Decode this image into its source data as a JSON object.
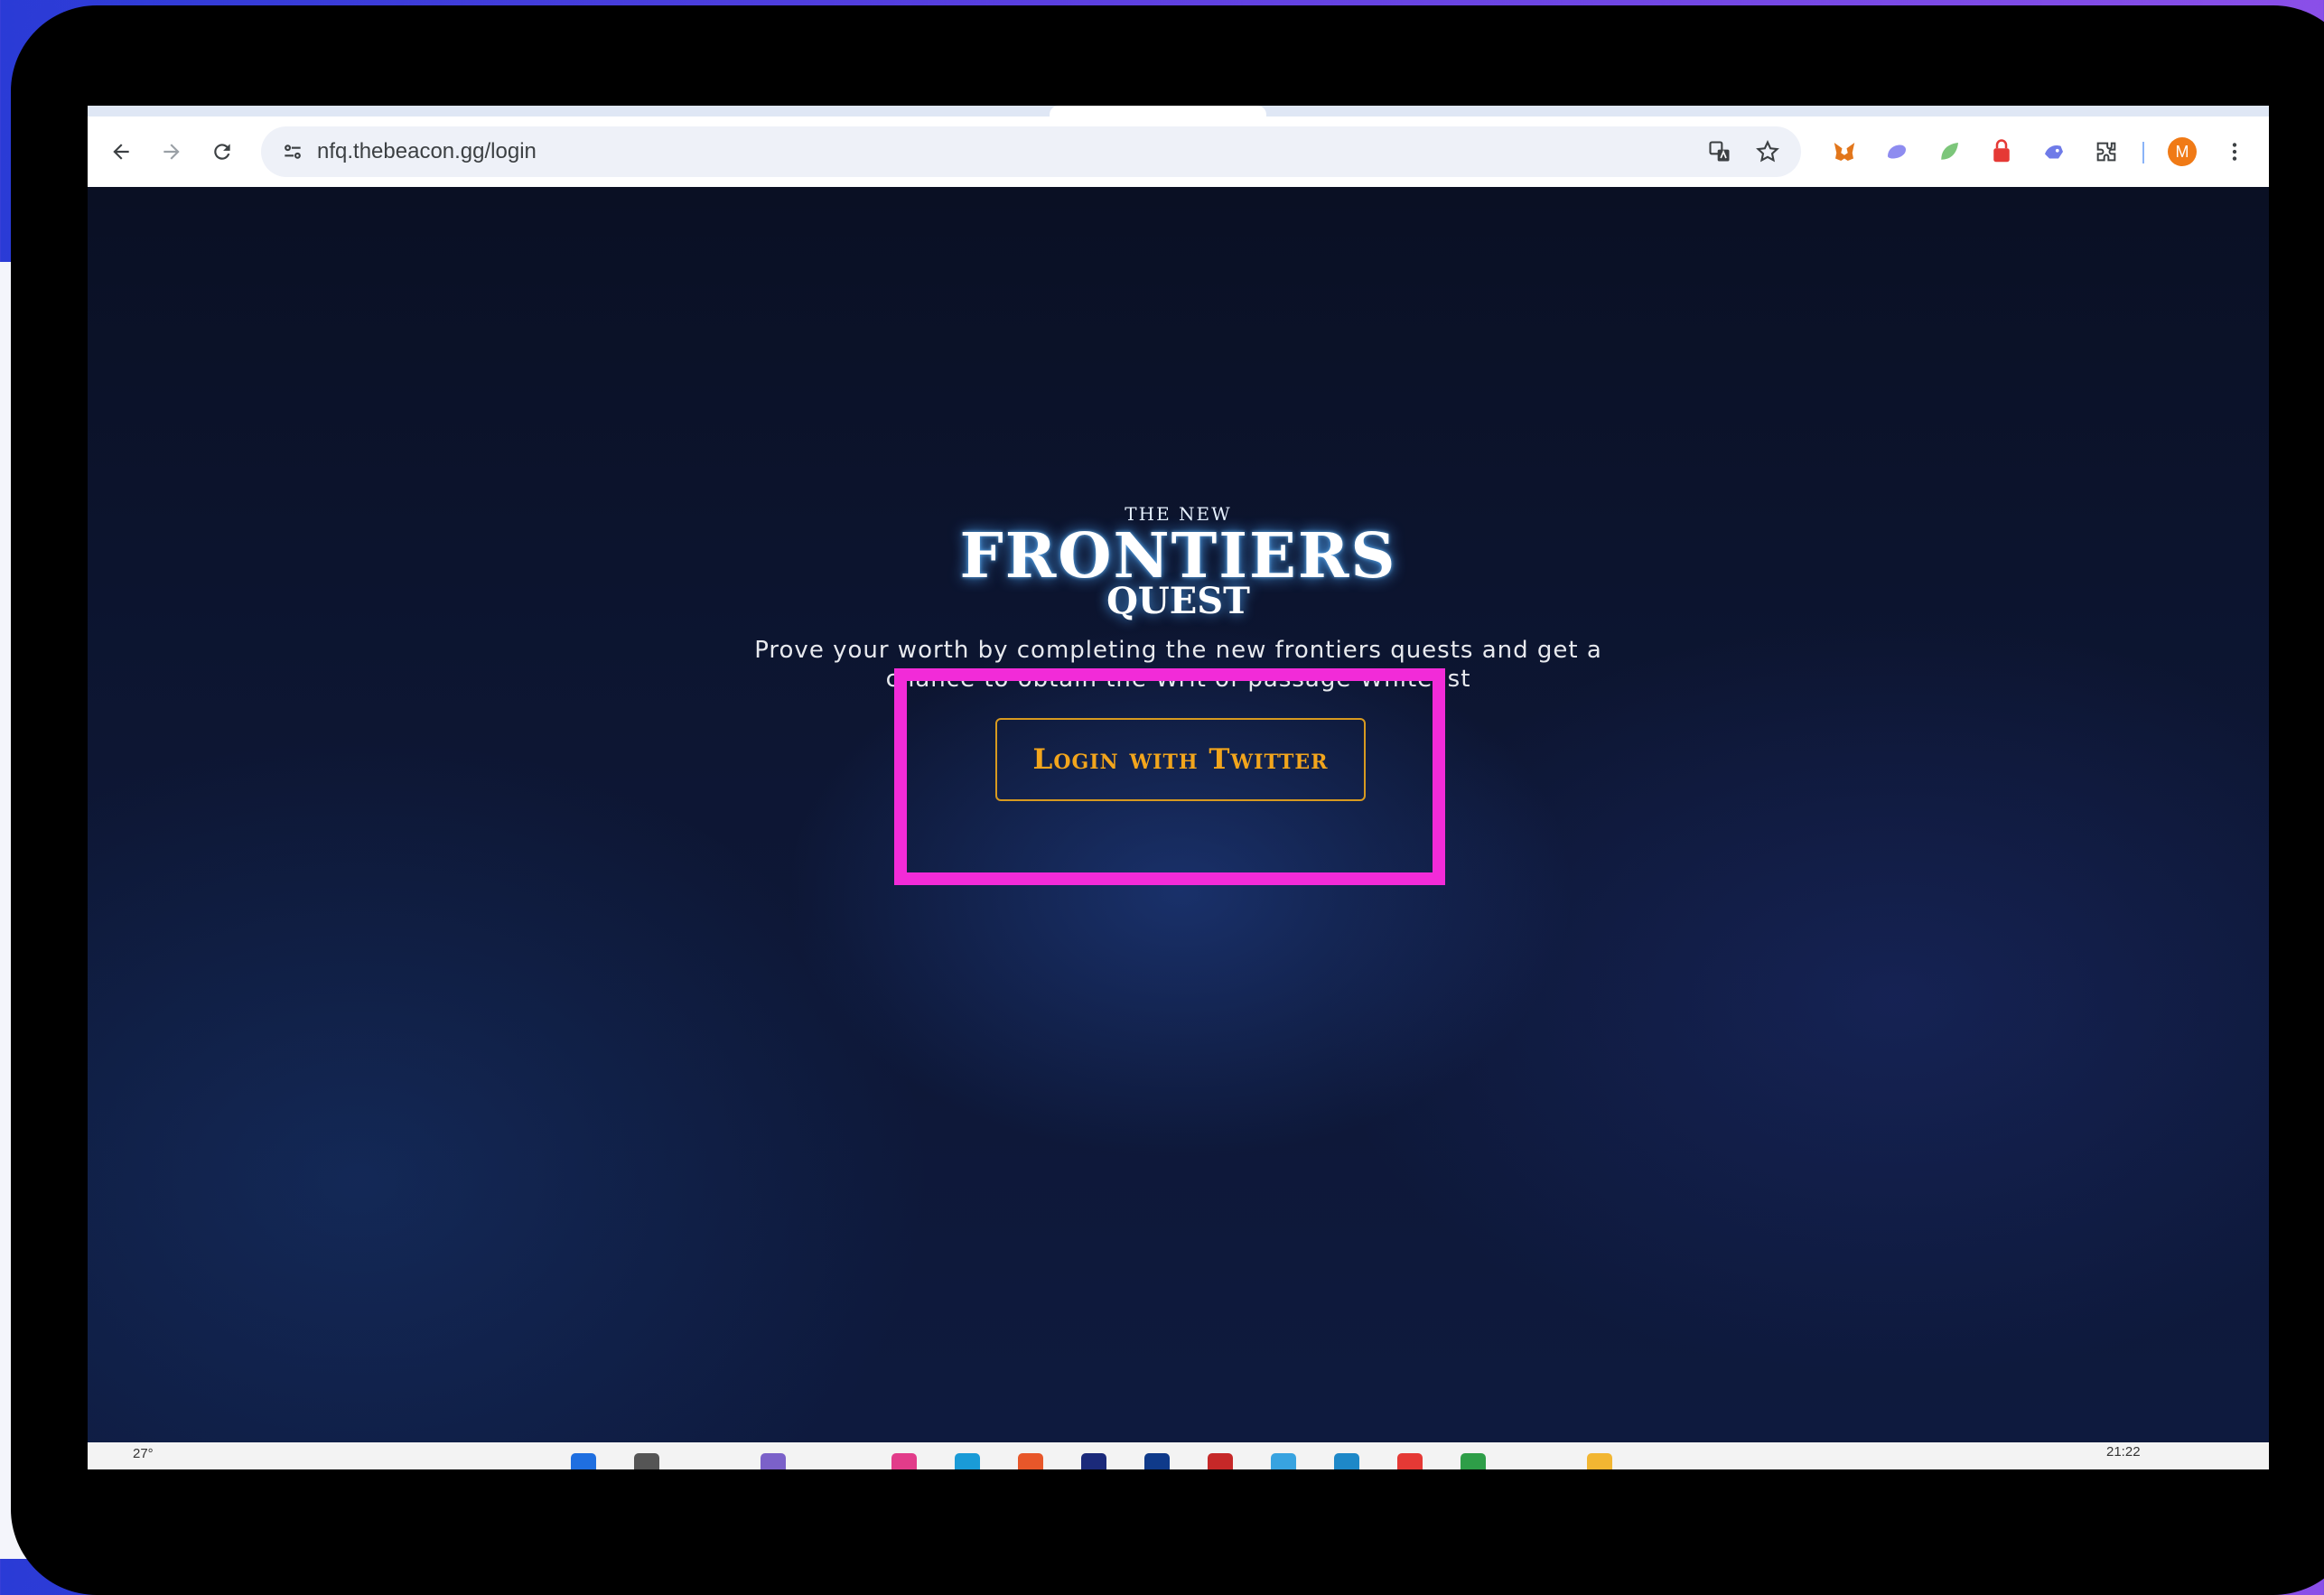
{
  "browser": {
    "url": "nfq.thebeacon.gg/login",
    "profile_initial": "M"
  },
  "page": {
    "logo": {
      "top": "THE NEW",
      "main": "FRONTIERS",
      "sub": "QUEST"
    },
    "tagline_line1": "Prove your worth by completing the new frontiers quests and get a",
    "tagline_line2": "chance to obtain the Writ of passage Whitelist",
    "login_button": "Login with Twitter",
    "colors": {
      "highlight": "#f22bd8",
      "button_accent": "#f2a51c"
    }
  },
  "taskbar": {
    "weather": "27°",
    "time": "21:22"
  }
}
